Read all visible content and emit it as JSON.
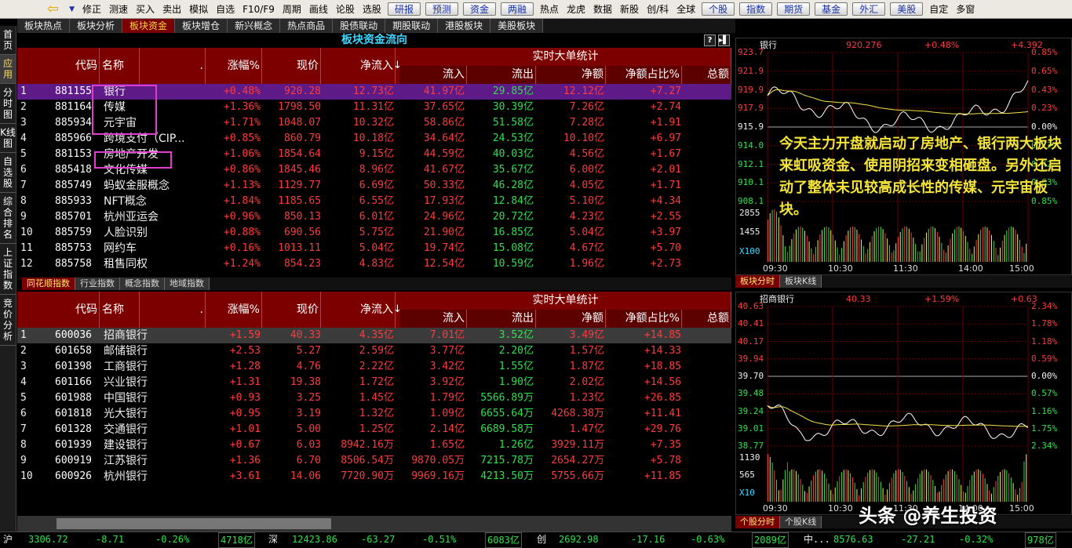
{
  "toolbar": {
    "items": [
      "修正",
      "测速",
      "买入",
      "卖出",
      "模拟",
      "自选",
      "F10/F9",
      "周期",
      "画线",
      "论股",
      "选股"
    ],
    "buttons": [
      "研报",
      "预测",
      "资金",
      "两融"
    ],
    "items2": [
      "热点",
      "龙虎",
      "数据",
      "新股",
      "创/科",
      "全球"
    ],
    "buttons2": [
      "个股",
      "指数",
      "期货",
      "基金",
      "外汇",
      "美股"
    ],
    "items3": [
      "自定",
      "多窗"
    ]
  },
  "tabs": [
    "板块热点",
    "板块分析",
    "板块资金",
    "板块增仓",
    "新兴概念",
    "热点商品",
    "股债联动",
    "期股联动",
    "港股板块",
    "美股板块"
  ],
  "active_tab": 2,
  "sidebar": [
    "首页",
    "应用",
    "分时图",
    "K线图",
    "自选股",
    "综合排名",
    "上证指数",
    "竞价分析"
  ],
  "top_panel": {
    "title": "板块资金流向",
    "help": "?",
    "columns": {
      "code": "代码",
      "name": "名称",
      "dot": ".",
      "chg": "涨幅%",
      "price": "现价",
      "net": "净流入",
      "group": "实时大单统计",
      "in": "流入",
      "out": "流出",
      "net2": "净额",
      "ratio": "净额占比%",
      "total": "总额"
    },
    "rows": [
      [
        "1",
        "881155",
        "银行",
        "+0.48%",
        "920.28",
        "12.73亿",
        "41.97亿",
        "29.85亿",
        "12.12亿",
        "+7.27"
      ],
      [
        "2",
        "881164",
        "传媒",
        "+1.36%",
        "1798.50",
        "11.31亿",
        "37.65亿",
        "30.39亿",
        "7.26亿",
        "+2.74"
      ],
      [
        "3",
        "885934",
        "元宇宙",
        "+1.71%",
        "1048.07",
        "10.32亿",
        "58.86亿",
        "51.58亿",
        "7.28亿",
        "+1.91"
      ],
      [
        "4",
        "885966",
        "跨境支付（CIP...",
        "+0.85%",
        "860.79",
        "10.18亿",
        "34.64亿",
        "24.53亿",
        "10.10亿",
        "+6.97"
      ],
      [
        "5",
        "881153",
        "房地产开发",
        "+1.06%",
        "1854.64",
        "9.15亿",
        "44.59亿",
        "40.03亿",
        "4.56亿",
        "+1.67"
      ],
      [
        "6",
        "885418",
        "文化传媒",
        "+0.86%",
        "1845.46",
        "8.96亿",
        "41.67亿",
        "35.67亿",
        "6.00亿",
        "+2.01"
      ],
      [
        "7",
        "885749",
        "蚂蚁金服概念",
        "+1.13%",
        "1129.77",
        "6.69亿",
        "50.33亿",
        "46.28亿",
        "4.05亿",
        "+1.71"
      ],
      [
        "8",
        "885933",
        "NFT概念",
        "+1.84%",
        "1185.65",
        "6.55亿",
        "17.93亿",
        "12.84亿",
        "5.10亿",
        "+4.34"
      ],
      [
        "9",
        "885701",
        "杭州亚运会",
        "+0.96%",
        "850.13",
        "6.01亿",
        "24.96亿",
        "20.72亿",
        "4.23亿",
        "+2.55"
      ],
      [
        "10",
        "885759",
        "人脸识别",
        "+0.88%",
        "690.56",
        "5.75亿",
        "21.90亿",
        "16.85亿",
        "5.04亿",
        "+3.97"
      ],
      [
        "11",
        "885753",
        "网约车",
        "+0.16%",
        "1013.11",
        "5.04亿",
        "19.74亿",
        "15.08亿",
        "4.67亿",
        "+5.70"
      ],
      [
        "12",
        "885758",
        "租售同权",
        "+1.24%",
        "854.23",
        "4.83亿",
        "12.54亿",
        "10.59亿",
        "1.96亿",
        "+2.73"
      ]
    ]
  },
  "mid_tabs": [
    "同花顺指数",
    "行业指数",
    "概念指数",
    "地域指数"
  ],
  "bottom_panel": {
    "columns": {
      "code": "代码",
      "name": "名称",
      "dot": ".",
      "chg": "涨幅%",
      "price": "现价",
      "net": "净流入",
      "group": "实时大单统计",
      "in": "流入",
      "out": "流出",
      "net2": "净额",
      "ratio": "净额占比%",
      "total": "总额"
    },
    "rows": [
      [
        "1",
        "600036",
        "招商银行",
        "+1.59",
        "40.33",
        "4.35亿",
        "7.01亿",
        "3.52亿",
        "3.49亿",
        "+14.85"
      ],
      [
        "2",
        "601658",
        "邮储银行",
        "+2.53",
        "5.27",
        "2.59亿",
        "3.77亿",
        "2.20亿",
        "1.57亿",
        "+14.33"
      ],
      [
        "3",
        "601398",
        "工商银行",
        "+1.28",
        "4.76",
        "2.22亿",
        "3.42亿",
        "1.55亿",
        "1.87亿",
        "+18.85"
      ],
      [
        "4",
        "601166",
        "兴业银行",
        "+1.31",
        "19.38",
        "1.72亿",
        "3.92亿",
        "1.90亿",
        "2.02亿",
        "+14.56"
      ],
      [
        "5",
        "601988",
        "中国银行",
        "+0.93",
        "3.25",
        "1.45亿",
        "1.79亿",
        "5566.89万",
        "1.23亿",
        "+26.85"
      ],
      [
        "6",
        "601818",
        "光大银行",
        "+0.95",
        "3.19",
        "1.32亿",
        "1.09亿",
        "6655.64万",
        "4268.38万",
        "+11.41"
      ],
      [
        "7",
        "601328",
        "交通银行",
        "+1.01",
        "5.00",
        "1.25亿",
        "2.14亿",
        "6689.58万",
        "1.47亿",
        "+29.76"
      ],
      [
        "8",
        "601939",
        "建设银行",
        "+0.67",
        "6.03",
        "8942.16万",
        "1.65亿",
        "1.26亿",
        "3929.11万",
        "+7.35"
      ],
      [
        "9",
        "600919",
        "江苏银行",
        "+1.36",
        "6.70",
        "8506.54万",
        "9870.05万",
        "7215.78万",
        "2654.27万",
        "+5.78"
      ],
      [
        "10",
        "600926",
        "杭州银行",
        "+3.61",
        "14.06",
        "7720.90万",
        "9969.16万",
        "4213.50万",
        "5755.66万",
        "+11.85"
      ]
    ]
  },
  "chart_top": {
    "name": "银行",
    "price": "920.276",
    "pct": "+0.48%",
    "chg": "+4.392",
    "left_ticks": [
      "923.7",
      "921.9",
      "919.9",
      "917.9",
      "915.9",
      "914.0",
      "912.1",
      "910.1",
      "908.1"
    ],
    "right_ticks": [
      "0.85%",
      "0.65%",
      "0.43%",
      "0.23%",
      "0.00%",
      "0.23%",
      "0.42%",
      "0.63%",
      "0.85%"
    ],
    "vol_ticks": [
      "2855",
      "1455",
      "X100"
    ],
    "times": [
      "09:30",
      "10:30",
      "11:30",
      "14:00",
      "15:00"
    ],
    "tabs": [
      "板块分时",
      "板块K线"
    ]
  },
  "chart_bottom": {
    "name": "招商银行",
    "price": "40.33",
    "pct": "+1.59%",
    "chg": "+0.63",
    "left_ticks": [
      "40.63",
      "40.41",
      "40.17",
      "39.94",
      "39.70",
      "39.48",
      "39.24",
      "39.01",
      "38.77"
    ],
    "right_ticks": [
      "2.34%",
      "1.78%",
      "1.18%",
      "0.59%",
      "0.00%",
      "0.57%",
      "1.16%",
      "1.75%",
      "2.34%"
    ],
    "vol_ticks": [
      "1130",
      "565",
      "X10"
    ],
    "times": [
      "09:30",
      "10:30",
      "11:30",
      "14:00",
      "15:00"
    ],
    "tabs": [
      "个股分时",
      "个股K线"
    ]
  },
  "annotation": "今天主力开盘就启动了房地产、银行两大板块来虹吸资金、使用阴招来变相砸盘。另外还启动了整体未见较高成长性的传媒、元宇宙板块。",
  "watermark": "头条 @养生投资",
  "status": {
    "sh_label": "沪",
    "sh": "3306.72",
    "sh_chg": "-8.71",
    "sh_pct": "-0.26%",
    "sh_amt": "4718亿",
    "sz_label": "深",
    "sz": "12423.86",
    "sz_chg": "-63.27",
    "sz_pct": "-0.51%",
    "sz_amt": "6083亿",
    "cy_label": "创",
    "cy": "2692.98",
    "cy_chg": "-17.16",
    "cy_pct": "-0.63%",
    "cy_amt": "2089亿",
    "zx_label": "中...",
    "zx": "8576.63",
    "zx_chg": "-27.21",
    "zx_pct": "-0.32%",
    "zx_amt": "978亿"
  },
  "colors": {
    "up": "#ff3b3b",
    "down": "#2de34a",
    "header_bg": "#7d0000",
    "highlight": "#e23ccd",
    "annotation": "#f4e43a"
  }
}
